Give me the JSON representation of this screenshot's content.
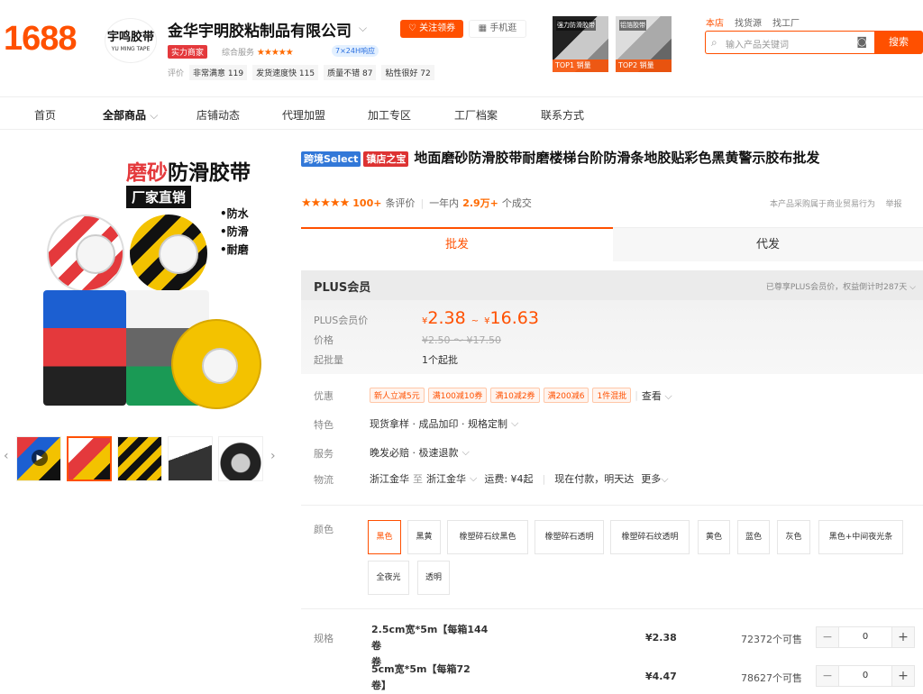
{
  "header": {
    "logo": "1688",
    "shop_avatar_line1": "宇鸣胶带",
    "shop_avatar_line2": "YU MING TAPE",
    "shop_name": "金华宇明胶粘制品有限公司",
    "follow_label": "关注领券",
    "phone_label": "手机逛",
    "badge_power": "实力商家",
    "combined_label": "综合服务",
    "badge_24h": "7×24H响应",
    "eval_label": "评价",
    "eval_chips": [
      "非常满意 119",
      "发货速度快 115",
      "质量不错 87",
      "粘性很好 72"
    ],
    "top1": {
      "title": "强力防滑胶带",
      "rank": "TOP1 销量"
    },
    "top2": {
      "title": "铝箔胶带",
      "rank": "TOP2 销量"
    }
  },
  "search": {
    "tabs": [
      "本店",
      "找货源",
      "找工厂"
    ],
    "placeholder": "输入产品关键词",
    "button": "搜索"
  },
  "nav": [
    "首页",
    "全部商品",
    "店铺动态",
    "代理加盟",
    "加工专区",
    "工厂档案",
    "联系方式"
  ],
  "gallery": {
    "headline_red": "磨砂",
    "headline_black": "防滑胶带",
    "subline": "厂家直销",
    "bullets": [
      "•防水",
      "•防滑",
      "•耐磨"
    ]
  },
  "product": {
    "tag_select": "跨境Select",
    "tag_shop": "镇店之宝",
    "title": "地面磨砂防滑胶带耐磨楼梯台阶防滑条地胶贴彩色黑黄警示胶布批发",
    "reviews_count": "100+",
    "reviews_label": "条评价",
    "year_label": "一年内",
    "deals_count": "2.9万+",
    "deals_label": "个成交",
    "trade_note": "本产品采购属于商业贸易行为",
    "report": "举报",
    "rating": 5
  },
  "tabs": {
    "wholesale": "批发",
    "dropship": "代发"
  },
  "plus": {
    "title": "PLUS会员",
    "right_note": "已尊享PLUS会员价，权益倒计时287天",
    "price_label": "PLUS会员价",
    "price_low": "2.38",
    "price_high": "16.63",
    "currency": "¥",
    "tilde": "~",
    "old_label": "价格",
    "old_price": "¥2.50 ～ ¥17.50",
    "moq_label": "起批量",
    "moq": "1个起批"
  },
  "details": {
    "coupon_label": "优惠",
    "coupons": [
      "新人立减5元",
      "满100减10券",
      "满10减2券",
      "满200减6",
      "1件混批"
    ],
    "coupon_more": "查看",
    "feature_label": "特色",
    "feature_value": "现货拿样 · 成品加印 · 规格定制",
    "service_label": "服务",
    "service_value": "晚发必赔 · 极速退款",
    "logistics_label": "物流",
    "from": "浙江金华",
    "to_word": "至",
    "to": "浙江金华",
    "freight": "运费: ¥4起",
    "delivery": "现在付款，明天达",
    "more": "更多"
  },
  "colors": {
    "label": "颜色",
    "options": [
      "黑色",
      "黑黄",
      "橡塑碎石纹黑色",
      "橡塑碎石透明",
      "橡塑碎石纹透明",
      "黄色",
      "蓝色",
      "灰色",
      "黑色+中间夜光条",
      "全夜光",
      "透明"
    ]
  },
  "specs": {
    "label": "规格",
    "rows": [
      {
        "name": "2.5cm宽*5m【每箱144卷",
        "name2": "卷",
        "price": "¥2.38",
        "stock": "72372个可售",
        "qty": "0"
      },
      {
        "name": "5cm宽*5m【每箱72",
        "name2": "卷】",
        "price": "¥4.47",
        "stock": "78627个可售",
        "qty": "0"
      }
    ]
  },
  "colors_palette": {
    "accent": "#ff5000",
    "tag_blue": "#3278d8",
    "tag_red": "#d33"
  }
}
